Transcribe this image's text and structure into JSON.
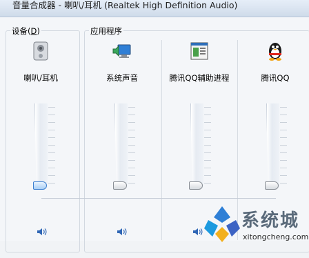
{
  "window": {
    "title": "音量合成器 - 喇叭/耳机 (Realtek High Definition Audio)"
  },
  "groups": {
    "device": {
      "label": "设备(",
      "accel": "D",
      "tail": ")"
    },
    "apps": {
      "label": "应用程序"
    }
  },
  "channels": [
    {
      "name": "喇叭/耳机",
      "icon": "speaker-device-icon",
      "level": 0.0
    },
    {
      "name": "系统声音",
      "icon": "system-sounds-icon",
      "level": 0.0
    },
    {
      "name": "腾讯QQ辅助进程",
      "icon": "qq-helper-icon",
      "level": 0.0
    },
    {
      "name": "腾讯QQ",
      "icon": "qq-penguin-icon",
      "level": 0.0
    }
  ],
  "watermark": {
    "text": "系统城",
    "url": "xitongcheng.com"
  },
  "colors": {
    "accent": "#3d7fd0",
    "titlebar": "#d8e4f1"
  }
}
